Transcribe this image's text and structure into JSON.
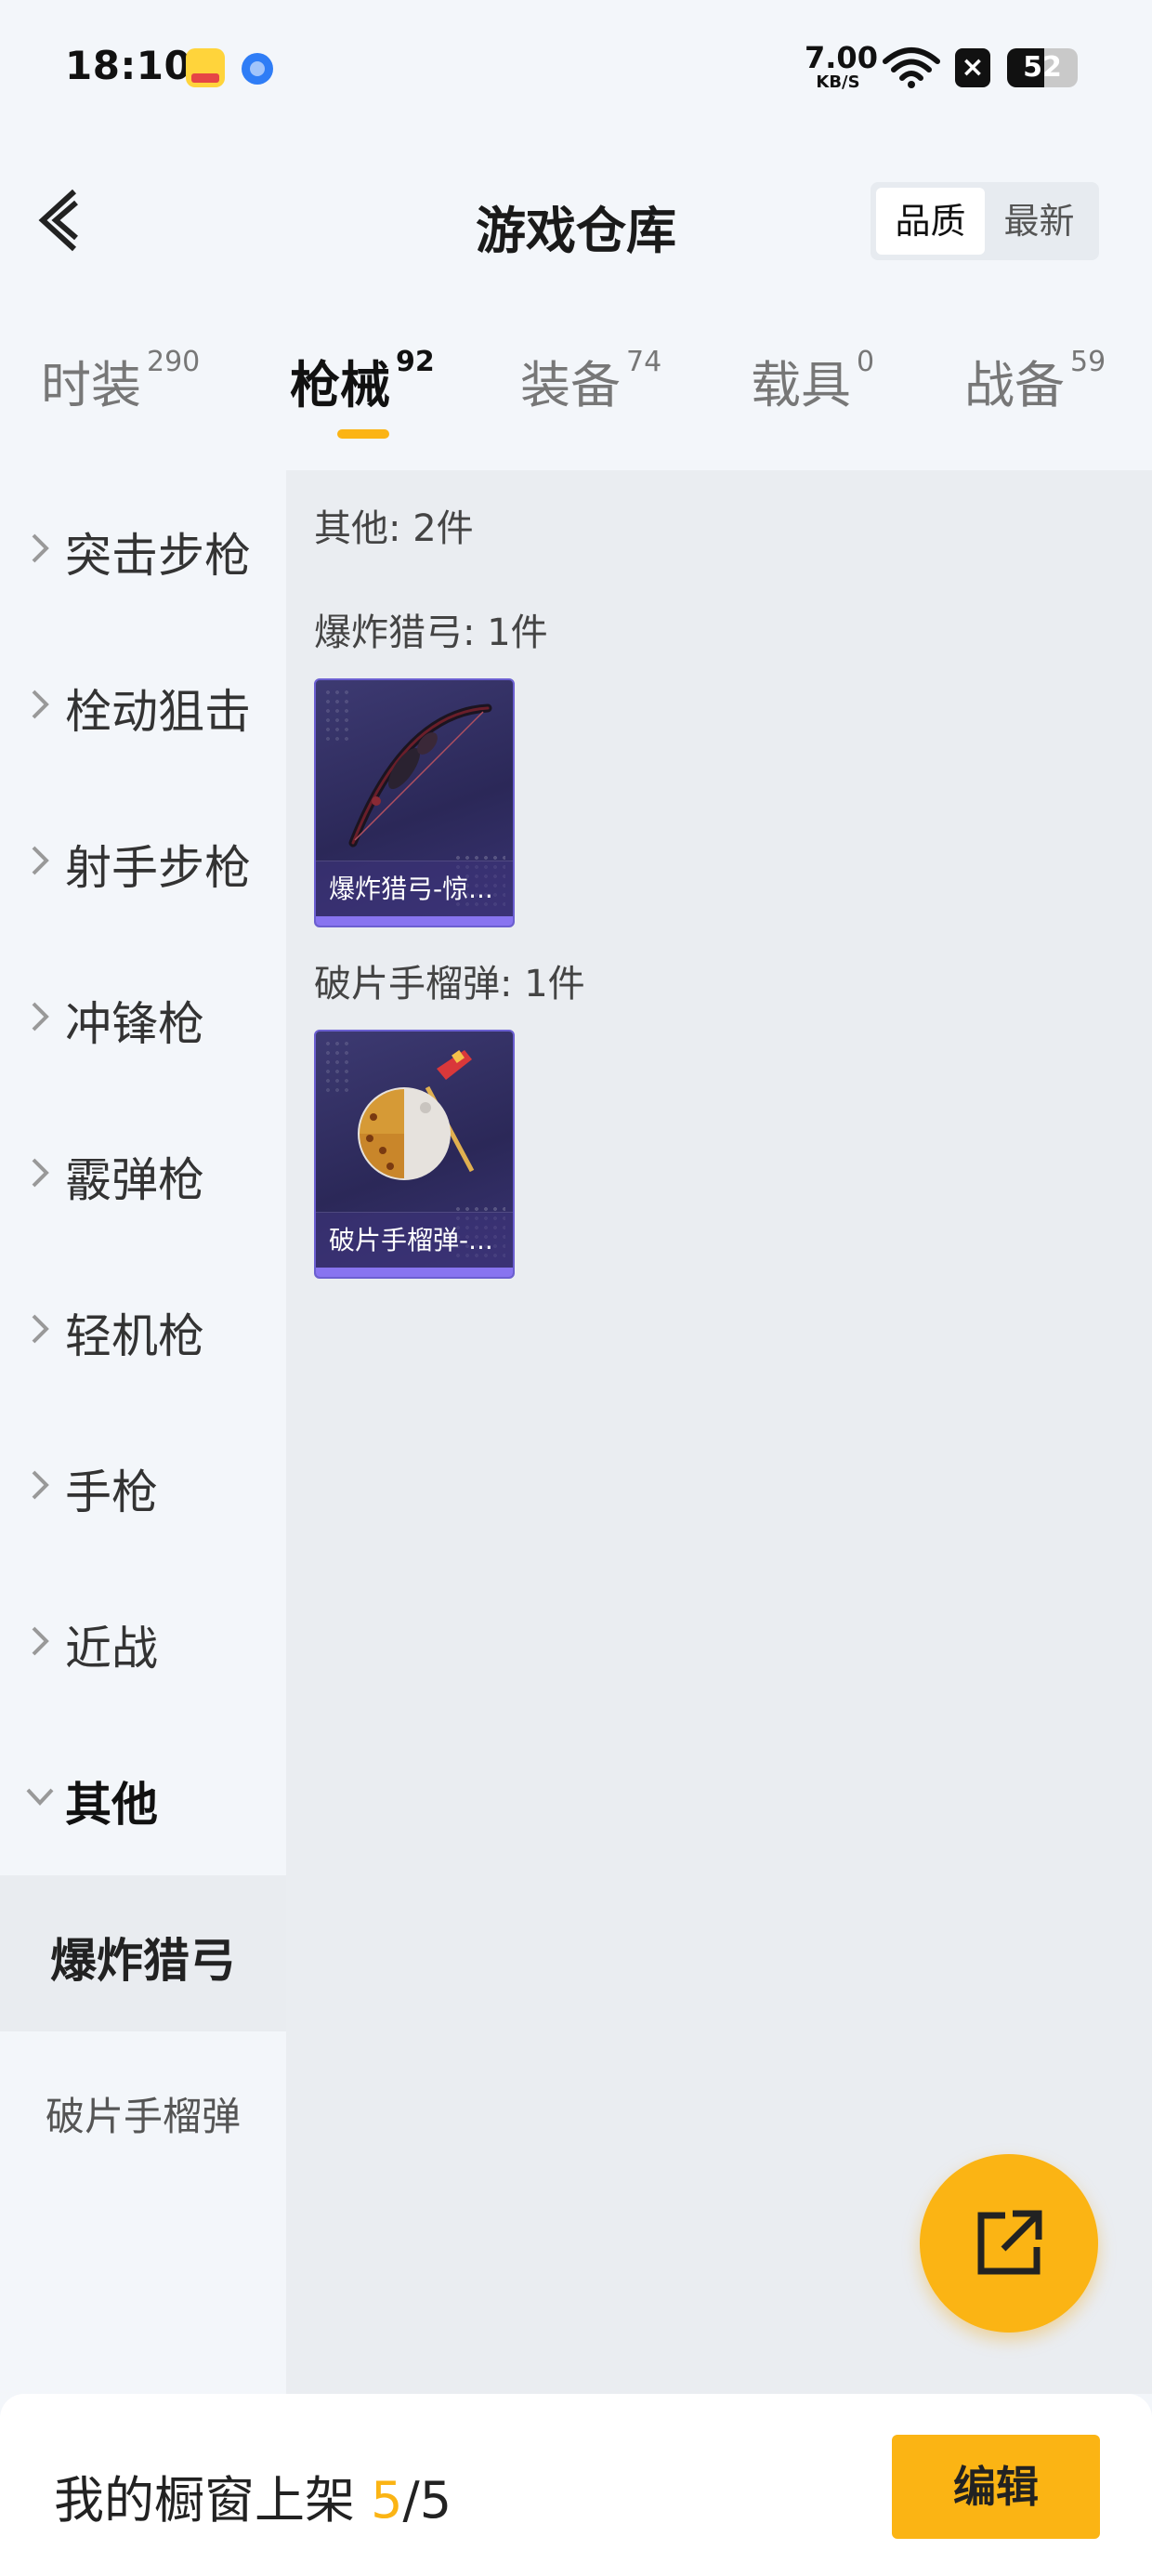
{
  "status_bar": {
    "time": "18:10",
    "net_speed_value": "7.00",
    "net_speed_unit": "KB/S",
    "battery": "52",
    "icons": [
      "app-notification-icon",
      "browser-icon",
      "wifi-icon",
      "close-icon",
      "battery-icon"
    ]
  },
  "header": {
    "title": "游戏仓库",
    "sort_options": [
      "品质",
      "最新"
    ],
    "sort_selected": "品质"
  },
  "tabs": [
    {
      "label": "时装",
      "count": "290",
      "active": false
    },
    {
      "label": "枪械",
      "count": "92",
      "active": true
    },
    {
      "label": "装备",
      "count": "74",
      "active": false
    },
    {
      "label": "载具",
      "count": "0",
      "active": false
    },
    {
      "label": "战备",
      "count": "59",
      "active": false
    }
  ],
  "categories": [
    {
      "label": "突击步枪",
      "expanded": false
    },
    {
      "label": "栓动狙击",
      "expanded": false
    },
    {
      "label": "射手步枪",
      "expanded": false
    },
    {
      "label": "冲锋枪",
      "expanded": false
    },
    {
      "label": "霰弹枪",
      "expanded": false
    },
    {
      "label": "轻机枪",
      "expanded": false
    },
    {
      "label": "手枪",
      "expanded": false
    },
    {
      "label": "近战",
      "expanded": false
    },
    {
      "label": "其他",
      "expanded": true
    }
  ],
  "subcategories": [
    {
      "label": "爆炸猎弓",
      "active": true
    },
    {
      "label": "破片手榴弹",
      "active": false
    }
  ],
  "content": {
    "section_title": "其他: 2件",
    "groups": [
      {
        "title": "爆炸猎弓: 1件",
        "items": [
          {
            "name": "爆炸猎弓-惊...",
            "icon": "bow-icon"
          }
        ]
      },
      {
        "title": "破片手榴弹: 1件",
        "items": [
          {
            "name": "破片手榴弹-...",
            "icon": "grenade-icon"
          }
        ]
      }
    ]
  },
  "bottom_bar": {
    "shelf_label": "我的橱窗上架 ",
    "shelf_current": "5",
    "shelf_sep": "/",
    "shelf_total": "5",
    "edit_label": "编辑"
  },
  "colors": {
    "accent": "#fbb414",
    "card_bg": "#2b2858",
    "card_border": "#6b5fd0"
  }
}
